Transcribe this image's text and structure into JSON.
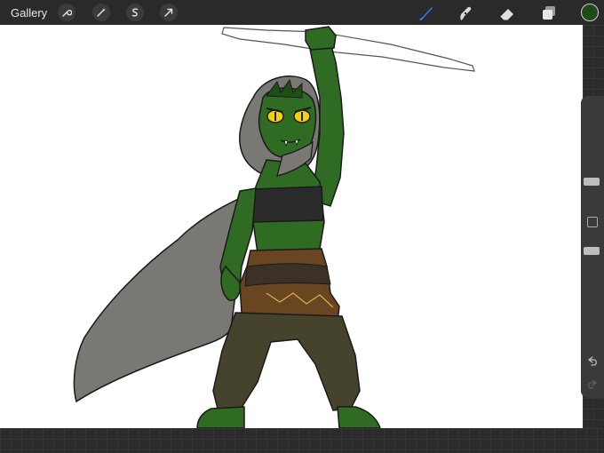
{
  "toolbar": {
    "gallery_label": "Gallery",
    "left_icons": [
      "wrench-icon",
      "magic-wand-icon",
      "selection-icon",
      "transform-arrow-icon"
    ],
    "right_icons": [
      "brush-icon",
      "smudge-icon",
      "eraser-icon",
      "layers-icon"
    ],
    "active_tool": "brush",
    "accent_color": "#2f7dff",
    "current_color": "#1f4a1a"
  },
  "sidebar": {
    "brush_size_level": 0.3,
    "opacity_level": 0.5,
    "icons": [
      "modify-square-icon",
      "undo-icon",
      "redo-icon"
    ]
  },
  "artwork": {
    "subject": "goblin-warrior-illustration",
    "palette": {
      "skin": "#2f6b23",
      "skin_dark": "#214d18",
      "cloak": "#7a7875",
      "top": "#2b2b2b",
      "belt": "#6a4521",
      "belt_accent": "#3b3126",
      "pants": "#46432c",
      "eyes": "#f2d20a"
    }
  }
}
